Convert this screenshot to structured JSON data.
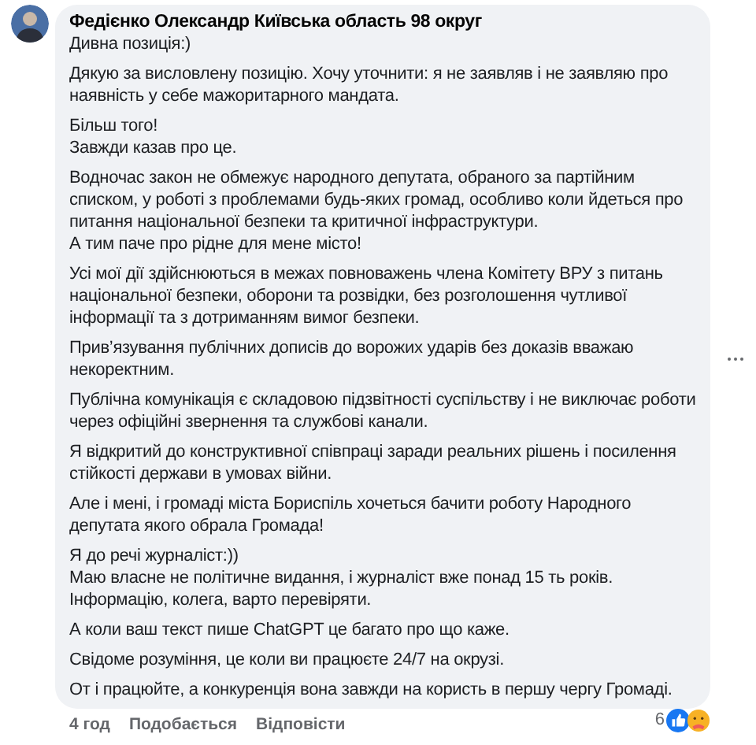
{
  "comment": {
    "author": "Федієнко Олександр Київська область 98 округ",
    "paragraphs": [
      [
        "Дивна позиція:)"
      ],
      [
        "Дякую за висловлену позицію. Хочу уточнити: я не заявляв і не заявляю про наявність у себе мажоритарного мандата."
      ],
      [
        "Більш того!",
        "Завжди казав про це."
      ],
      [
        "Водночас закон не обмежує народного депутата, обраного за партійним списком, у роботі з проблемами будь-яких громад, особливо коли йдеться про питання національної безпеки та критичної інфраструктури.",
        "А тим паче про рідне для мене місто!"
      ],
      [
        "Усі мої дії здійснюються в межах повноважень члена Комітету ВРУ з питань національної безпеки, оборони та розвідки, без розголошення чутливої інформації та з дотриманням вимог безпеки."
      ],
      [
        "Прив’язування публічних дописів до ворожих ударів без доказів вважаю некоректним."
      ],
      [
        "Публічна комунікація є складовою підзвітності суспільству і не виключає роботи через офіційні звернення та службові канали."
      ],
      [
        "Я відкритий до конструктивної співпраці заради реальних рішень і посилення стійкості держави в умовах війни."
      ],
      [
        "Але і мені, і громаді міста Бориспіль хочеться бачити роботу Народного депутата якого обрала Громада!"
      ],
      [
        "Я до речі журналіст:))",
        "Маю власне не політичне видання, і журналіст вже понад 15 ть років.",
        "Інформацію, колега, варто перевіряти."
      ],
      [
        "А коли ваш текст пише ChatGPT це багато про що каже."
      ],
      [
        "Свідоме розуміння, це коли ви працюєте 24/7 на окрузі."
      ],
      [
        "От і працюйте, а конкуренція вона завжди на користь в першу чергу Громаді."
      ]
    ]
  },
  "footer": {
    "time": "4 год",
    "like": "Подобається",
    "reply": "Відповісти"
  },
  "reactions": {
    "count": "6"
  }
}
